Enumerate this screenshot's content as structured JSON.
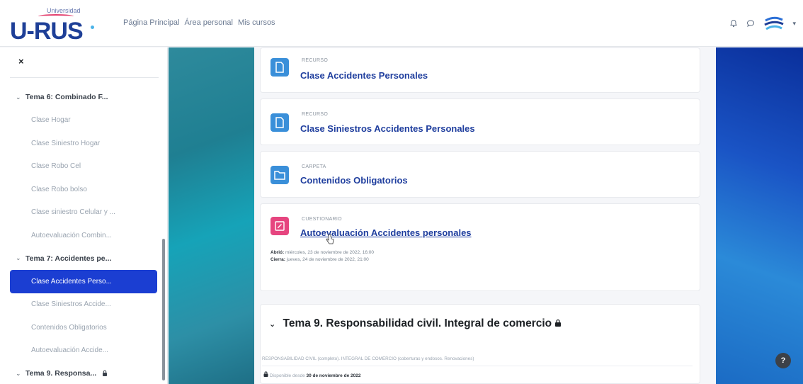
{
  "navbar": {
    "logo": {
      "top": "Universidad",
      "main": "U-RUS"
    },
    "links": [
      "Página Principal",
      "Área personal",
      "Mis cursos"
    ],
    "icons": [
      "bell-icon",
      "chat-icon"
    ],
    "colors": {
      "brand": "#1e3f97",
      "accent": "#1b3ed2"
    }
  },
  "sidebar": {
    "close_label": "×",
    "items": [
      {
        "label": "Tema 6: Combinado F...",
        "type": "section"
      },
      {
        "label": "Clase Hogar",
        "type": "item"
      },
      {
        "label": "Clase Siniestro Hogar",
        "type": "item"
      },
      {
        "label": "Clase Robo Cel",
        "type": "item"
      },
      {
        "label": "Clase Robo bolso",
        "type": "item"
      },
      {
        "label": "Clase siniestro Celular y ...",
        "type": "item"
      },
      {
        "label": "Autoevaluación Combin...",
        "type": "item"
      },
      {
        "label": "Tema 7: Accidentes pe...",
        "type": "section"
      },
      {
        "label": "Clase Accidentes Perso...",
        "type": "active"
      },
      {
        "label": "Clase Siniestros Accide...",
        "type": "item"
      },
      {
        "label": "Contenidos Obligatorios",
        "type": "item"
      },
      {
        "label": "Autoevaluación Accide...",
        "type": "item"
      },
      {
        "label": "Tema 9. Responsa...",
        "type": "section-locked"
      }
    ]
  },
  "activities": [
    {
      "type": "RECURSO",
      "name": "Clase Accidentes Personales",
      "icon": "file-icon"
    },
    {
      "type": "RECURSO",
      "name": "Clase Siniestros Accidentes Personales",
      "icon": "file-icon"
    },
    {
      "type": "CARPETA",
      "name": "Contenidos Obligatorios",
      "icon": "folder-icon"
    },
    {
      "type": "CUESTIONARIO",
      "name": "Autoevaluación Accidentes personales",
      "icon": "quiz-icon",
      "opens_label": "Abrió:",
      "opens_value": "miércoles, 23 de noviembre de 2022, 16:00",
      "closes_label": "Cierra:",
      "closes_value": "jueves, 24 de noviembre de 2022, 21:00"
    }
  ],
  "section": {
    "title": "Tema 9. Responsabilidad civil. Integral de comercio",
    "description": "RESPONSABILIDAD CIVIL (completo). INTEGRAL DE COMERCIO (coberturas y endosos. Renovaciones)",
    "availability_prefix": "Disponible desde",
    "availability_date": "30 de noviembre de 2022"
  },
  "help": {
    "label": "?"
  }
}
